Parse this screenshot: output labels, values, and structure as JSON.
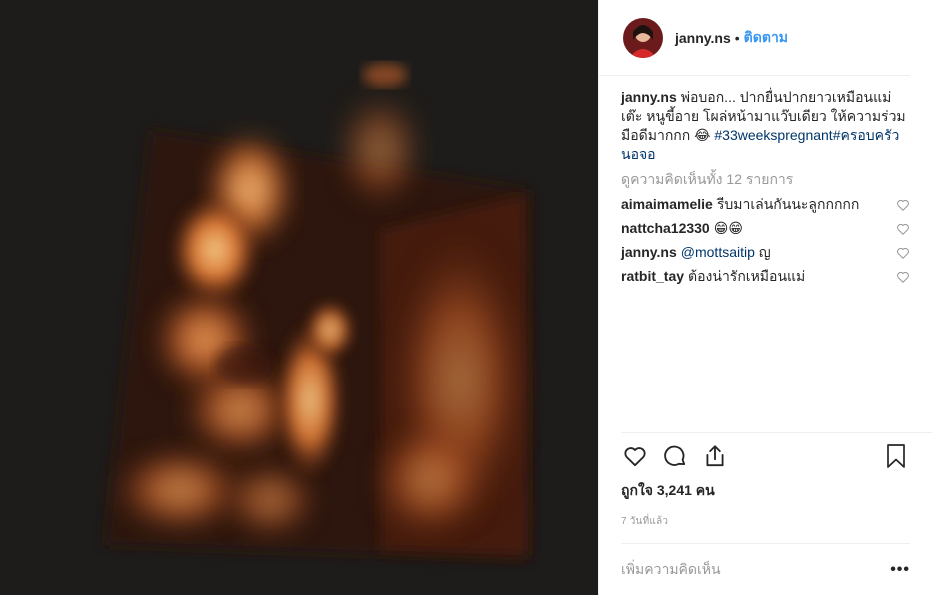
{
  "post": {
    "username": "janny.ns",
    "separator": "•",
    "follow_label": "ติดตาม",
    "caption_user": "janny.ns",
    "caption_text": "พ่อบอก... ปากยื่นปากยาวเหมือนแม่เต๊ะ หนูขี้อาย โผล่หน้ามาแว๊บเดียว ให้ความร่วมมือดีมากกก 😂 ",
    "caption_tags": "#33weekspregnant#ครอบครัวนอจอ",
    "view_all": "ดูความคิดเห็นทั้ง 12 รายการ",
    "comments": [
      {
        "user": "aimaimamelie",
        "text": "รีบมาเล่นกันนะลูกกกกก"
      },
      {
        "user": "nattcha12330",
        "text": "😁😁"
      },
      {
        "user": "janny.ns",
        "mention": "@mottsaitip",
        "text": " ญ"
      },
      {
        "user": "ratbit_tay",
        "text": "ต้องน่ารักเหมือนแม่"
      }
    ],
    "likes": "ถูกใจ 3,241 คน",
    "time": "7 วันที่แล้ว",
    "add_comment_placeholder": "เพิ่มความคิดเห็น",
    "more_label": "•••"
  },
  "icons": {
    "like": "heart-icon",
    "comment": "comment-bubble-icon",
    "share": "share-icon",
    "save": "bookmark-icon"
  },
  "colors": {
    "follow_blue": "#3897f0",
    "hashtag": "#003569",
    "muted": "#999999",
    "media_bg": "#141311",
    "ultrasound_orange": "#d9702a"
  }
}
